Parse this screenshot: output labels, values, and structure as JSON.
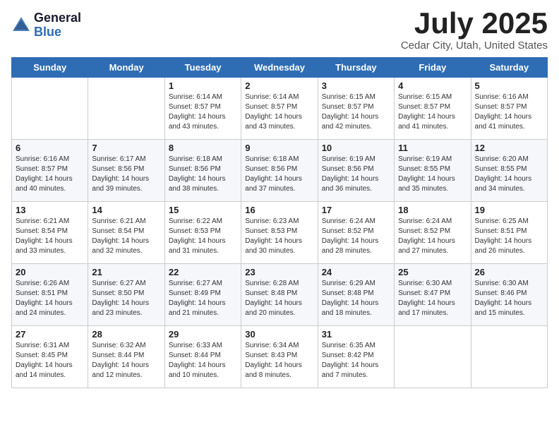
{
  "header": {
    "logo_general": "General",
    "logo_blue": "Blue",
    "month_title": "July 2025",
    "location": "Cedar City, Utah, United States"
  },
  "days_of_week": [
    "Sunday",
    "Monday",
    "Tuesday",
    "Wednesday",
    "Thursday",
    "Friday",
    "Saturday"
  ],
  "weeks": [
    [
      {
        "day": "",
        "sunrise": "",
        "sunset": "",
        "daylight": ""
      },
      {
        "day": "",
        "sunrise": "",
        "sunset": "",
        "daylight": ""
      },
      {
        "day": "1",
        "sunrise": "Sunrise: 6:14 AM",
        "sunset": "Sunset: 8:57 PM",
        "daylight": "Daylight: 14 hours and 43 minutes."
      },
      {
        "day": "2",
        "sunrise": "Sunrise: 6:14 AM",
        "sunset": "Sunset: 8:57 PM",
        "daylight": "Daylight: 14 hours and 43 minutes."
      },
      {
        "day": "3",
        "sunrise": "Sunrise: 6:15 AM",
        "sunset": "Sunset: 8:57 PM",
        "daylight": "Daylight: 14 hours and 42 minutes."
      },
      {
        "day": "4",
        "sunrise": "Sunrise: 6:15 AM",
        "sunset": "Sunset: 8:57 PM",
        "daylight": "Daylight: 14 hours and 41 minutes."
      },
      {
        "day": "5",
        "sunrise": "Sunrise: 6:16 AM",
        "sunset": "Sunset: 8:57 PM",
        "daylight": "Daylight: 14 hours and 41 minutes."
      }
    ],
    [
      {
        "day": "6",
        "sunrise": "Sunrise: 6:16 AM",
        "sunset": "Sunset: 8:57 PM",
        "daylight": "Daylight: 14 hours and 40 minutes."
      },
      {
        "day": "7",
        "sunrise": "Sunrise: 6:17 AM",
        "sunset": "Sunset: 8:56 PM",
        "daylight": "Daylight: 14 hours and 39 minutes."
      },
      {
        "day": "8",
        "sunrise": "Sunrise: 6:18 AM",
        "sunset": "Sunset: 8:56 PM",
        "daylight": "Daylight: 14 hours and 38 minutes."
      },
      {
        "day": "9",
        "sunrise": "Sunrise: 6:18 AM",
        "sunset": "Sunset: 8:56 PM",
        "daylight": "Daylight: 14 hours and 37 minutes."
      },
      {
        "day": "10",
        "sunrise": "Sunrise: 6:19 AM",
        "sunset": "Sunset: 8:56 PM",
        "daylight": "Daylight: 14 hours and 36 minutes."
      },
      {
        "day": "11",
        "sunrise": "Sunrise: 6:19 AM",
        "sunset": "Sunset: 8:55 PM",
        "daylight": "Daylight: 14 hours and 35 minutes."
      },
      {
        "day": "12",
        "sunrise": "Sunrise: 6:20 AM",
        "sunset": "Sunset: 8:55 PM",
        "daylight": "Daylight: 14 hours and 34 minutes."
      }
    ],
    [
      {
        "day": "13",
        "sunrise": "Sunrise: 6:21 AM",
        "sunset": "Sunset: 8:54 PM",
        "daylight": "Daylight: 14 hours and 33 minutes."
      },
      {
        "day": "14",
        "sunrise": "Sunrise: 6:21 AM",
        "sunset": "Sunset: 8:54 PM",
        "daylight": "Daylight: 14 hours and 32 minutes."
      },
      {
        "day": "15",
        "sunrise": "Sunrise: 6:22 AM",
        "sunset": "Sunset: 8:53 PM",
        "daylight": "Daylight: 14 hours and 31 minutes."
      },
      {
        "day": "16",
        "sunrise": "Sunrise: 6:23 AM",
        "sunset": "Sunset: 8:53 PM",
        "daylight": "Daylight: 14 hours and 30 minutes."
      },
      {
        "day": "17",
        "sunrise": "Sunrise: 6:24 AM",
        "sunset": "Sunset: 8:52 PM",
        "daylight": "Daylight: 14 hours and 28 minutes."
      },
      {
        "day": "18",
        "sunrise": "Sunrise: 6:24 AM",
        "sunset": "Sunset: 8:52 PM",
        "daylight": "Daylight: 14 hours and 27 minutes."
      },
      {
        "day": "19",
        "sunrise": "Sunrise: 6:25 AM",
        "sunset": "Sunset: 8:51 PM",
        "daylight": "Daylight: 14 hours and 26 minutes."
      }
    ],
    [
      {
        "day": "20",
        "sunrise": "Sunrise: 6:26 AM",
        "sunset": "Sunset: 8:51 PM",
        "daylight": "Daylight: 14 hours and 24 minutes."
      },
      {
        "day": "21",
        "sunrise": "Sunrise: 6:27 AM",
        "sunset": "Sunset: 8:50 PM",
        "daylight": "Daylight: 14 hours and 23 minutes."
      },
      {
        "day": "22",
        "sunrise": "Sunrise: 6:27 AM",
        "sunset": "Sunset: 8:49 PM",
        "daylight": "Daylight: 14 hours and 21 minutes."
      },
      {
        "day": "23",
        "sunrise": "Sunrise: 6:28 AM",
        "sunset": "Sunset: 8:48 PM",
        "daylight": "Daylight: 14 hours and 20 minutes."
      },
      {
        "day": "24",
        "sunrise": "Sunrise: 6:29 AM",
        "sunset": "Sunset: 8:48 PM",
        "daylight": "Daylight: 14 hours and 18 minutes."
      },
      {
        "day": "25",
        "sunrise": "Sunrise: 6:30 AM",
        "sunset": "Sunset: 8:47 PM",
        "daylight": "Daylight: 14 hours and 17 minutes."
      },
      {
        "day": "26",
        "sunrise": "Sunrise: 6:30 AM",
        "sunset": "Sunset: 8:46 PM",
        "daylight": "Daylight: 14 hours and 15 minutes."
      }
    ],
    [
      {
        "day": "27",
        "sunrise": "Sunrise: 6:31 AM",
        "sunset": "Sunset: 8:45 PM",
        "daylight": "Daylight: 14 hours and 14 minutes."
      },
      {
        "day": "28",
        "sunrise": "Sunrise: 6:32 AM",
        "sunset": "Sunset: 8:44 PM",
        "daylight": "Daylight: 14 hours and 12 minutes."
      },
      {
        "day": "29",
        "sunrise": "Sunrise: 6:33 AM",
        "sunset": "Sunset: 8:44 PM",
        "daylight": "Daylight: 14 hours and 10 minutes."
      },
      {
        "day": "30",
        "sunrise": "Sunrise: 6:34 AM",
        "sunset": "Sunset: 8:43 PM",
        "daylight": "Daylight: 14 hours and 8 minutes."
      },
      {
        "day": "31",
        "sunrise": "Sunrise: 6:35 AM",
        "sunset": "Sunset: 8:42 PM",
        "daylight": "Daylight: 14 hours and 7 minutes."
      },
      {
        "day": "",
        "sunrise": "",
        "sunset": "",
        "daylight": ""
      },
      {
        "day": "",
        "sunrise": "",
        "sunset": "",
        "daylight": ""
      }
    ]
  ]
}
